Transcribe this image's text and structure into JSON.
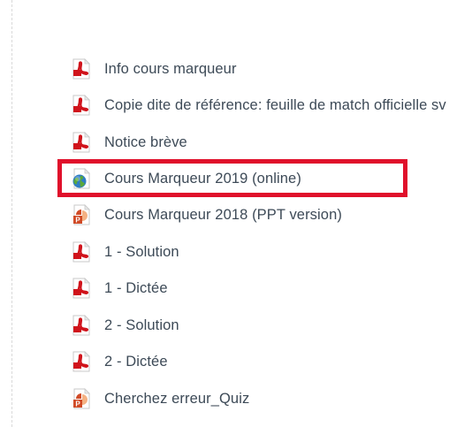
{
  "resources": [
    {
      "label": "Info cours marqueur",
      "icon": "pdf-icon"
    },
    {
      "label": "Copie dite de référence: feuille de match officielle sv",
      "icon": "pdf-icon"
    },
    {
      "label": "Notice brève",
      "icon": "pdf-icon"
    },
    {
      "label": "Cours Marqueur 2019 (online)",
      "icon": "globe-link-icon"
    },
    {
      "label": "Cours Marqueur 2018 (PPT version)",
      "icon": "powerpoint-icon"
    },
    {
      "label": "1 - Solution",
      "icon": "pdf-icon"
    },
    {
      "label": "1 - Dictée",
      "icon": "pdf-icon"
    },
    {
      "label": "2 - Solution",
      "icon": "pdf-icon"
    },
    {
      "label": "2 - Dictée",
      "icon": "pdf-icon"
    },
    {
      "label": "Cherchez erreur_Quiz",
      "icon": "powerpoint-icon"
    }
  ],
  "colors": {
    "text": "#3d4a57",
    "highlight": "#e0102b",
    "pdf_red": "#d0131b",
    "ppt_orange": "#d04a26",
    "globe_blue": "#2f7dc4",
    "globe_green": "#5aa83a"
  }
}
